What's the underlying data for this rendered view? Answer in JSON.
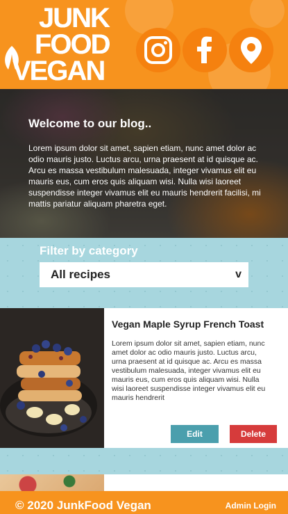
{
  "header": {
    "logo_line1": "JUNK",
    "logo_line2": "FOOD",
    "logo_line3": "VEGAN",
    "social": [
      {
        "icon": "instagram-icon"
      },
      {
        "icon": "facebook-icon"
      },
      {
        "icon": "location-pin-icon"
      }
    ]
  },
  "hero": {
    "title": "Welcome to our blog..",
    "text": "Lorem ipsum dolor sit amet, sapien etiam, nunc amet dolor ac odio mauris justo. Luctus arcu, urna praesent at id quisque ac. Arcu es massa vestibulum malesuada, integer vivamus elit eu mauris eus, cum eros quis aliquam wisi. Nulla wisi laoreet suspendisse integer vivamus elit eu mauris hendrerit facilisi, mi mattis pariatur aliquam pharetra eget."
  },
  "filter": {
    "label": "Filter by category",
    "selected": "All recipes",
    "chevron": "v"
  },
  "recipes": [
    {
      "title": "Vegan Maple Syrup French Toast",
      "excerpt": "Lorem ipsum dolor sit amet, sapien etiam, nunc amet dolor ac odio mauris justo. Luctus arcu, urna praesent at id quisque ac. Arcu es massa vestibulum malesuada, integer vivamus elit eu mauris eus, cum eros quis aliquam wisi. Nulla wisi laoreet suspendisse integer vivamus elit eu mauris hendrerit",
      "edit_label": "Edit",
      "delete_label": "Delete"
    }
  ],
  "footer": {
    "copyright": "© 2020 JunkFood Vegan",
    "admin_label": "Admin Login"
  },
  "colors": {
    "brand_orange": "#f7931e",
    "filter_band": "#a7d6de",
    "edit_button": "#4b9fad",
    "delete_button": "#d63b3b"
  }
}
